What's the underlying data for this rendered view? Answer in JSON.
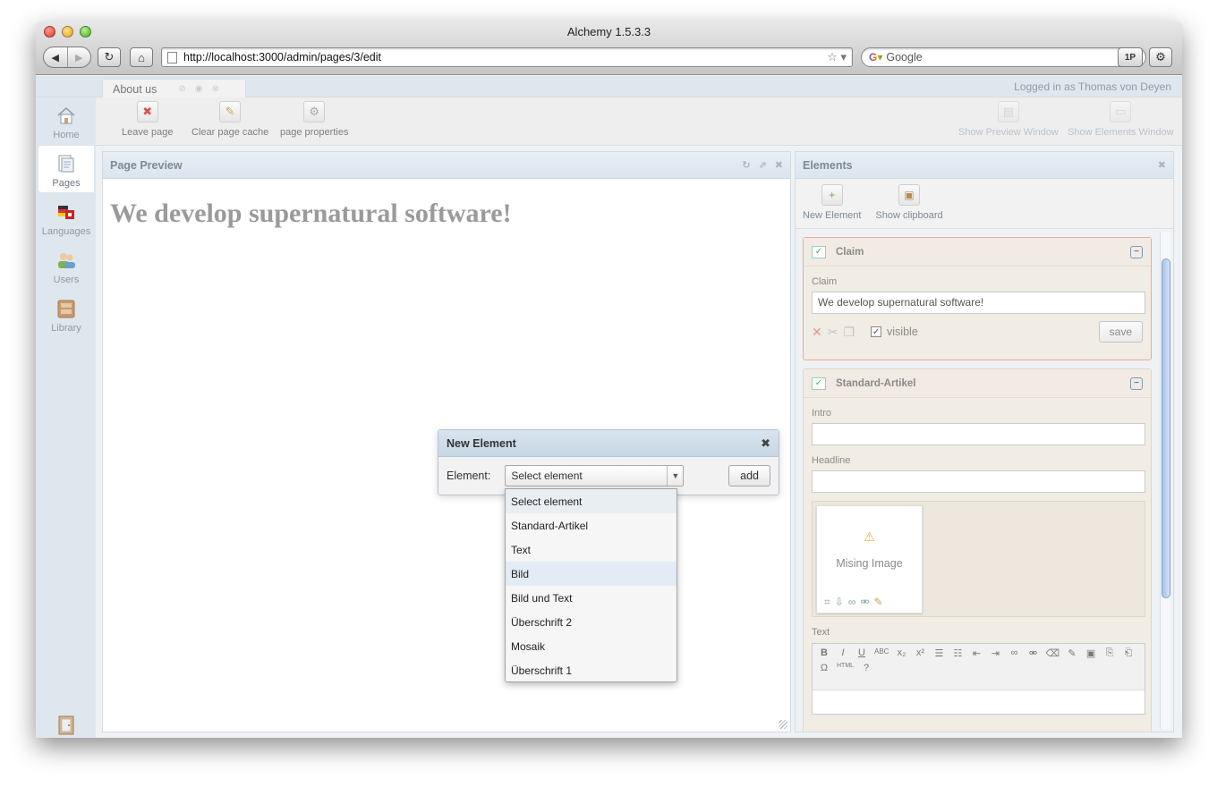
{
  "browser": {
    "title": "Alchemy 1.5.3.3",
    "url": "http://localhost:3000/admin/pages/3/edit",
    "search_placeholder": "Google",
    "onepassword_label": "1P"
  },
  "app": {
    "page_tab": "About us",
    "logged_in": "Logged in as Thomas von Deyen"
  },
  "sidebar": {
    "items": [
      {
        "label": "Home"
      },
      {
        "label": "Pages"
      },
      {
        "label": "Languages"
      },
      {
        "label": "Users"
      },
      {
        "label": "Library"
      }
    ],
    "logout": "logout"
  },
  "toolbar": {
    "leave_page": "Leave page",
    "clear_cache": "Clear page cache",
    "page_properties": "page properties",
    "show_preview": "Show Preview Window",
    "show_elements": "Show Elements Window"
  },
  "preview": {
    "title": "Page Preview",
    "headline": "We develop supernatural software!"
  },
  "elements_panel": {
    "title": "Elements",
    "new_element": "New Element",
    "show_clipboard": "Show clipboard",
    "claim": {
      "name": "Claim",
      "field_label": "Claim",
      "field_value": "We develop supernatural software!",
      "visible_label": "visible",
      "save_label": "save"
    },
    "standard": {
      "name": "Standard-Artikel",
      "intro_label": "Intro",
      "headline_label": "Headline",
      "missing_image": "Mising Image",
      "text_label": "Text",
      "rte_html": "HTML"
    }
  },
  "dialog": {
    "title": "New Element",
    "element_label": "Element:",
    "selected": "Select element",
    "add_label": "add",
    "options": [
      "Select element",
      "Standard-Artikel",
      "Text",
      "Bild",
      "Bild und Text",
      "Überschrift 2",
      "Mosaik",
      "Überschrift 1"
    ]
  }
}
